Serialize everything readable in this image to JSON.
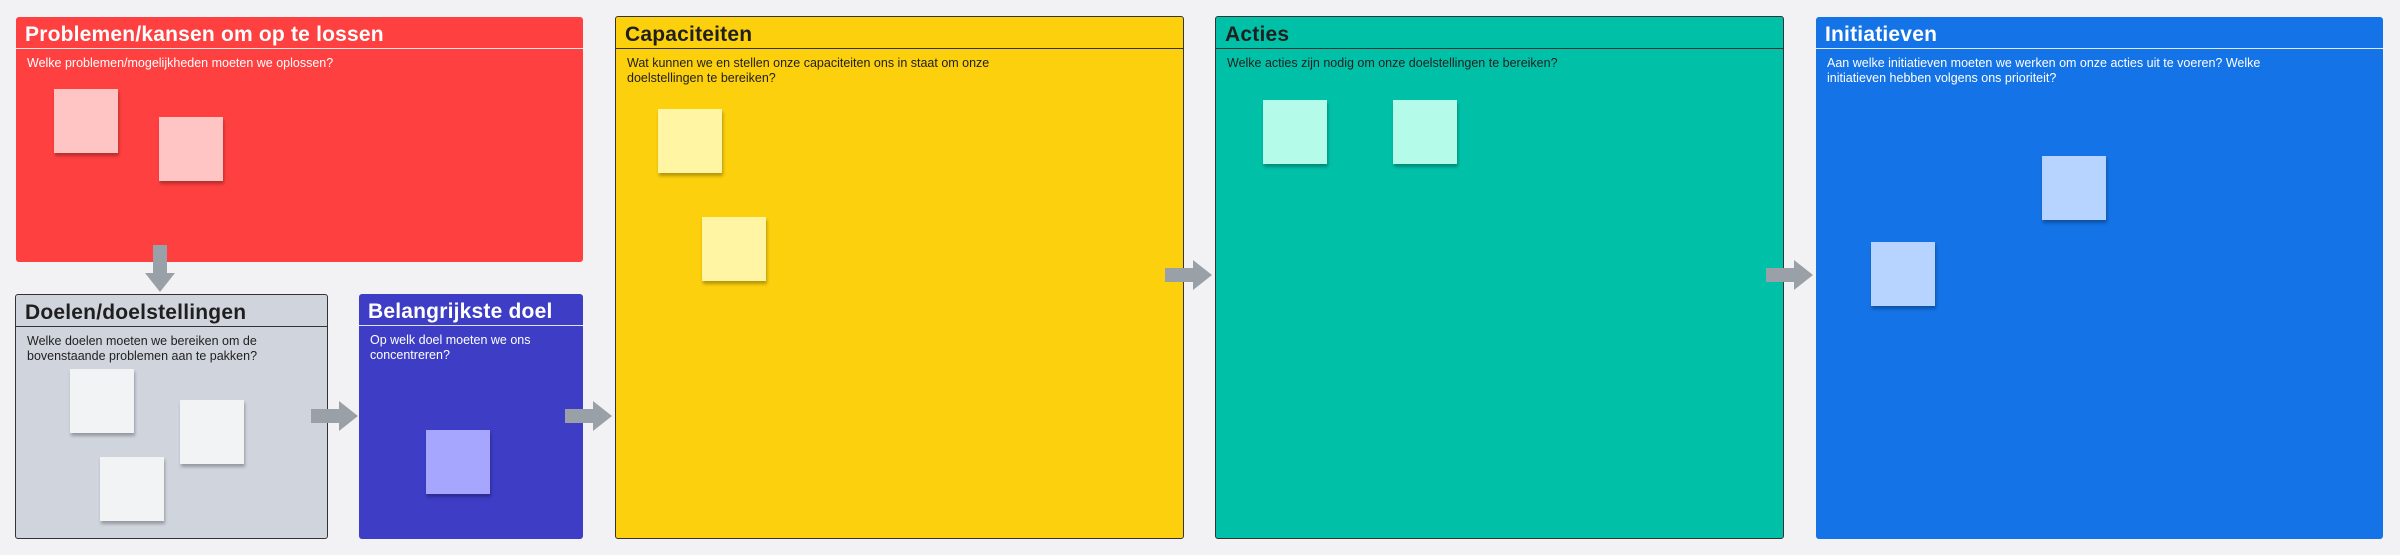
{
  "frames": {
    "problems": {
      "title": "Problemen/kansen om op te lossen",
      "description": "Welke problemen/mogelijkheden moeten we oplossen?",
      "color": "#ff4040",
      "sticky_color": "#ffc4c4"
    },
    "goals": {
      "title": "Doelen/doelstellingen",
      "description": "Welke doelen moeten we bereiken om de bovenstaande problemen aan te pakken?",
      "color": "#d0d5dd",
      "sticky_color": "#f2f3f5"
    },
    "main_goal": {
      "title": "Belangrijkste doel",
      "description": "Op welk doel moeten we ons concentreren?",
      "color": "#3d3dc6",
      "sticky_color": "#a6a6ff"
    },
    "capacities": {
      "title": "Capaciteiten",
      "description": "Wat kunnen we en stellen onze capaciteiten ons in staat om onze doelstellingen te bereiken?",
      "color": "#fcd00d",
      "sticky_color": "#fff5a3"
    },
    "actions": {
      "title": "Acties",
      "description": "Welke acties zijn nodig om onze doelstellingen te bereiken?",
      "color": "#00c1a8",
      "sticky_color": "#b5fbe9"
    },
    "initiatives": {
      "title": "Initiatieven",
      "description": "Aan welke initiatieven moeten we werken om onze acties uit te voeren? Welke initiatieven hebben volgens ons prioriteit?",
      "color": "#1473e6",
      "sticky_color": "#b6d4ff"
    }
  },
  "arrow_color": "#9aa0a8"
}
